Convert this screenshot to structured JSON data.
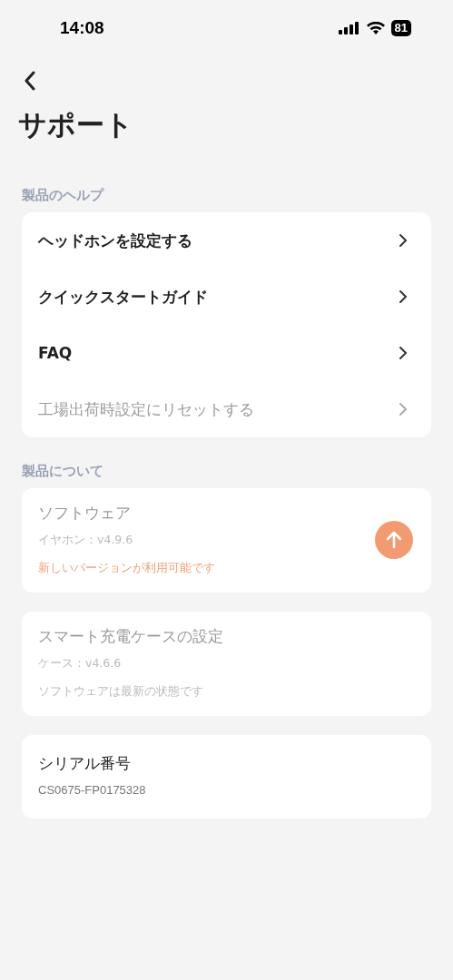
{
  "status_bar": {
    "time": "14:08",
    "battery": "81"
  },
  "header": {
    "title": "サポート"
  },
  "help_section": {
    "label": "製品のヘルプ",
    "items": [
      {
        "label": "ヘッドホンを設定する",
        "disabled": false
      },
      {
        "label": "クイックスタートガイド",
        "disabled": false
      },
      {
        "label": "FAQ",
        "disabled": false
      },
      {
        "label": "工場出荷時設定にリセットする",
        "disabled": true
      }
    ]
  },
  "about_section": {
    "label": "製品について",
    "cards": [
      {
        "title": "ソフトウェア",
        "disabled": true,
        "version": "イヤホン：v4.9.6",
        "note": "新しいバージョンが利用可能です",
        "update_available": true
      },
      {
        "title": "スマート充電ケースの設定",
        "disabled": true,
        "version": "ケース：v4.6.6",
        "note": "ソフトウェアは最新の状態です",
        "update_available": false
      }
    ]
  },
  "serial": {
    "title": "シリアル番号",
    "value": "CS0675-FP0175328"
  }
}
